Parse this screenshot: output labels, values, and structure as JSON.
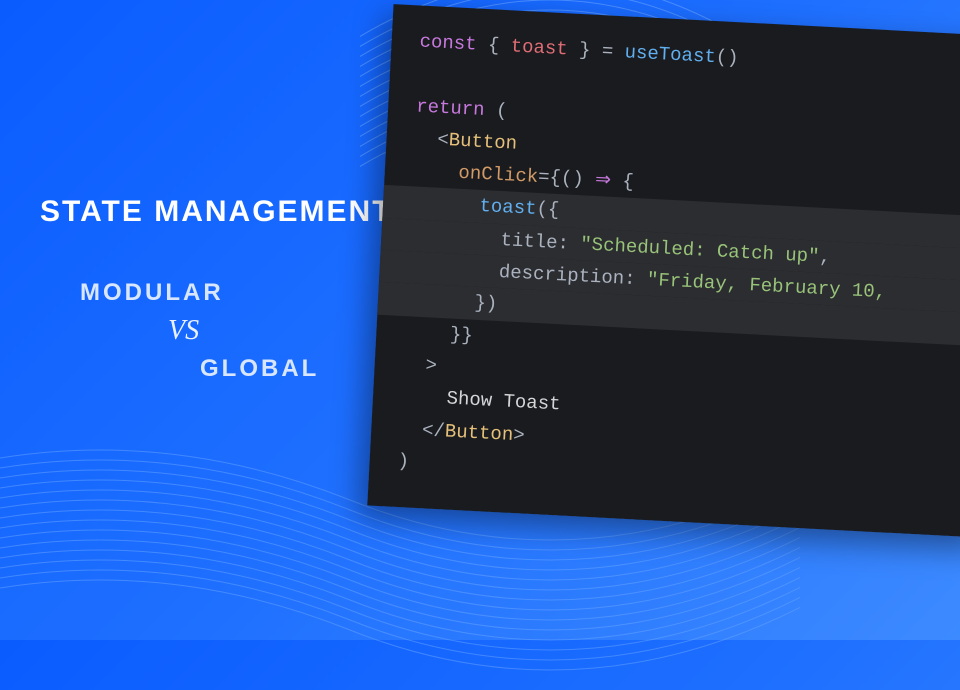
{
  "headline": {
    "title": "STATE MANAGEMENT",
    "line1": "MODULAR",
    "vs": "VS",
    "line2": "GLOBAL"
  },
  "code": {
    "l1_const": "const",
    "l1_brace_open": " { ",
    "l1_toast": "toast",
    "l1_brace_close": " } ",
    "l1_eq": "= ",
    "l1_fn": "useToast",
    "l1_call": "()",
    "l3_return": "return",
    "l3_paren": " (",
    "l4_open": "<",
    "l4_tag": "Button",
    "l5_attr": "onClick",
    "l5_eq": "=",
    "l5_brace": "{",
    "l5_paren": "() ",
    "l5_arrow": "⇒",
    "l5_brace2": " {",
    "l6_fn": "toast",
    "l6_call": "({",
    "l7_prop": "title: ",
    "l7_str": "\"Scheduled: Catch up\"",
    "l7_comma": ",",
    "l8_prop": "description: ",
    "l8_str": "\"Friday, February 10,",
    "l9_close": "})",
    "l10_close": "}}",
    "l11_gt": ">",
    "l12_text": "Show Toast",
    "l13_close_open": "</",
    "l13_tag": "Button",
    "l13_gt": ">",
    "l14_paren": ")"
  }
}
